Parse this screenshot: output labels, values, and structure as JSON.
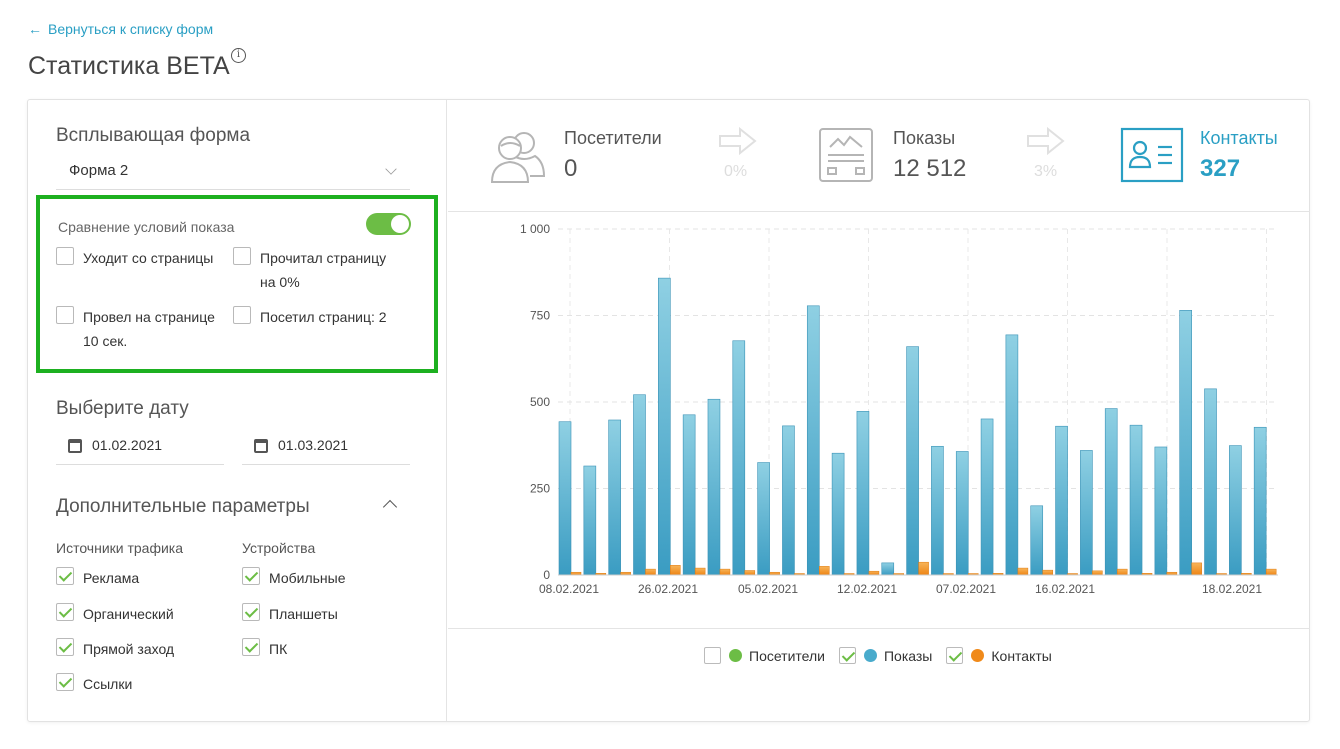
{
  "header": {
    "back_link": "Вернуться к списку форм",
    "title": "Статистика BETA"
  },
  "form_select": {
    "section_title": "Всплывающая форма",
    "selected": "Форма 2"
  },
  "compare": {
    "title": "Сравнение условий показа",
    "enabled": true,
    "conditions": [
      {
        "label": "Уходит со страницы",
        "checked": false
      },
      {
        "label": "Прочитал страницу на 0%",
        "checked": false
      },
      {
        "label": "Провел на странице 10 сек.",
        "checked": false
      },
      {
        "label": "Посетил страниц: 2",
        "checked": false
      }
    ]
  },
  "dates": {
    "section_title": "Выберите дату",
    "from": "01.02.2021",
    "to": "01.03.2021"
  },
  "extra": {
    "section_title": "Дополнительные параметры",
    "traffic_title": "Источники трафика",
    "traffic": [
      {
        "label": "Реклама",
        "checked": true
      },
      {
        "label": "Органический",
        "checked": true
      },
      {
        "label": "Прямой заход",
        "checked": true
      },
      {
        "label": "Ссылки",
        "checked": true
      }
    ],
    "devices_title": "Устройства",
    "devices": [
      {
        "label": "Мобильные",
        "checked": true
      },
      {
        "label": "Планшеты",
        "checked": true
      },
      {
        "label": "ПК",
        "checked": true
      }
    ]
  },
  "stats": {
    "visitors": {
      "label": "Посетители",
      "value": "0"
    },
    "conv1": "0%",
    "impressions": {
      "label": "Показы",
      "value": "12 512"
    },
    "conv2": "3%",
    "contacts": {
      "label": "Контакты",
      "value": "327"
    }
  },
  "colors": {
    "accent": "#2a9fc4",
    "green": "#6cbd45",
    "highlight": "#1db020",
    "bar_blue": "#49abcc",
    "bar_orange": "#f08a1a"
  },
  "chart_data": {
    "type": "bar",
    "ylim": [
      0,
      1000
    ],
    "yticks": [
      "0",
      "250",
      "500",
      "750",
      "1 000"
    ],
    "xtick_labels": [
      "08.02.2021",
      "26.02.2021",
      "05.02.2021",
      "12.02.2021",
      "07.02.2021",
      "16.02.2021",
      "18.02.2021"
    ],
    "grid": true,
    "series": [
      {
        "name": "Посетители",
        "visible": false,
        "values": []
      },
      {
        "name": "Показы",
        "visible": true,
        "values": [
          443,
          315,
          448,
          521,
          858,
          463,
          508,
          677,
          325,
          431,
          778,
          352,
          473,
          35,
          660,
          372,
          357,
          451,
          694,
          200,
          430,
          360,
          481,
          433,
          370,
          765,
          538,
          374,
          427
        ]
      },
      {
        "name": "Контакты",
        "visible": true,
        "values": [
          8,
          5,
          8,
          17,
          28,
          20,
          17,
          13,
          8,
          3,
          25,
          3,
          11,
          2,
          37,
          2,
          4,
          5,
          20,
          14,
          3,
          12,
          17,
          5,
          8,
          35,
          3,
          5,
          17
        ]
      }
    ]
  }
}
